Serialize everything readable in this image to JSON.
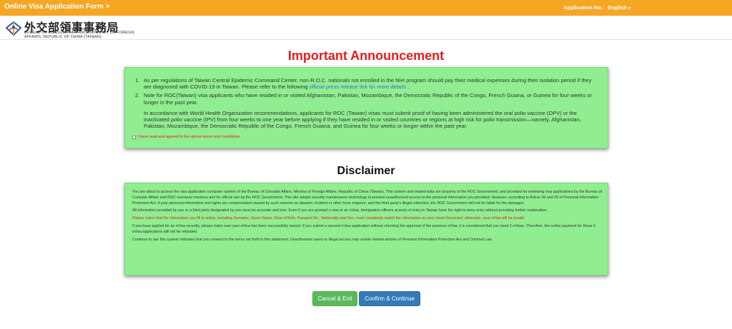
{
  "topbar": {
    "title": "Online Visa Application Form >",
    "application_no_label": "Application No.:",
    "language": "English",
    "language_caret": "▾",
    "bg_color": "#f5a623"
  },
  "brand": {
    "logo_icon": "ministry-logo-icon",
    "name_cn": "外交部領事事務局",
    "name_en_line1": "BUREAU OF CONSULAR AFFAIRS, MINISTRY OF FOREIGN",
    "name_en_line2": "AFFAIRS, REPUBLIC OF CHINA (TAIWAN)"
  },
  "announcement": {
    "title": "Important Announcement",
    "items": [
      {
        "number": "1.",
        "text": "As per regulations of Taiwan Central Epidemic Command Center, non-R.O.C. nationals not enrolled in the NHI program should pay their medical expenses during their isolation period if they are diagnosed with COVID-19 in Taiwan. Please refer to the following ",
        "link": "official press release link for more details",
        "after": " ."
      },
      {
        "number": "2.",
        "text": "Note for ROC(Taiwan) visa applicants who have resided in or visited Afghanistan, Pakistan, Mozambique, the Democratic Republic of the Congo, French Guiana, or Guinea for four weeks or longer in the past year.",
        "text2": "In accordance with World Health Organization recommendations, applicants for ROC (Taiwan) visas must submit proof of having been administered the oral polio vaccine (OPV) or the inactivated polio vaccine (IPV) from four weeks to one year before applying if they have resided in or visited countries or regions at high risk for polio transmission—namely, Afghanistan, Pakistan, Mozambique, the Democratic Republic of the Congo, French Guiana, and Guinea for four weeks or longer within the past year."
      }
    ],
    "agree_label": "I have read and agreed to the above terms and conditions",
    "agree_checked": false
  },
  "disclaimer": {
    "title": "Disclaimer",
    "paragraphs": [
      "You are about to access the visa application computer system of the Bureau of Consular Affairs, Ministry of Foreign Affairs, Republic of China (Taiwan). This system and related data are property of the ROC Government, and provided for reviewing visa applications by the Bureau of Consular Affairs and ROC overseas missions and for official use by the ROC Government. This site adopts security maintenance technology to prevent unauthorized access to the personal information you provided. However, according to Article 28 and 29 of Personal Information Protection Act, if your personal information and rights are compensated caused by such reasons as disaster, incident or other force majeure, and the third party's illegal collection, the ROC Government will not be liable for the damages.",
      "All information provided by you or a third party designated by you must be accurate and true. Even if you are granted a visa or an eVisa, immigration officers at ports of entry in Taiwan have the right to deny entry without providing further explanation.",
      "Please notice that the information you fill in online, including Surname, Given Name, Date of Birth, Passport No., Nationality and Sex, must completely match the information on your travel document; otherwise, your eVisa will be invalid.",
      "If you have applied for an eVisa recently, please make sure your eVisa has been successfully issued. If you submit a second eVisa application without checking the approval of the previous eVisa, it is considered that you need 2 eVisas. Therefore, the online payment for these 2 eVisa applications will not be refunded.",
      "Continue to use this system indicates that you consent to the terms set forth in this statement. Unauthorized users or illegal access may violate related articles of Personal Information Protection Act and Criminal Law."
    ]
  },
  "buttons": {
    "cancel_label": "Cancel & Exit",
    "confirm_label": "Confirm & Continue"
  }
}
